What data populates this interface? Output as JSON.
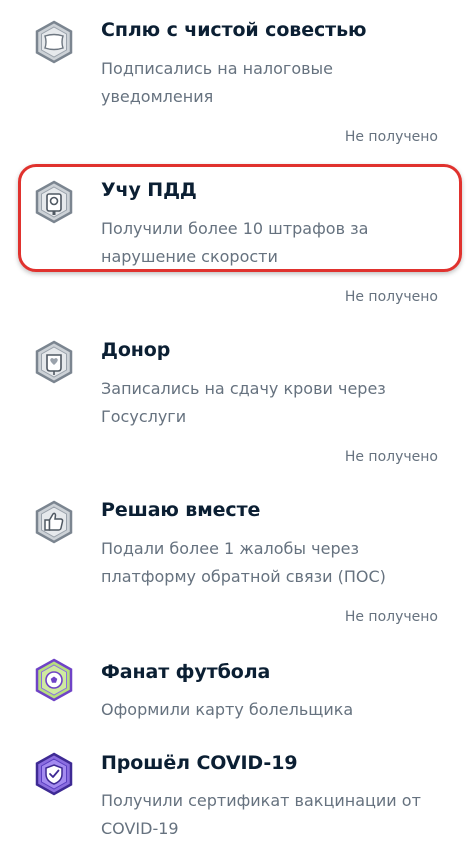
{
  "achievements": [
    {
      "title": "Сплю с чистой совестью",
      "description": "Подписались на налоговые уведомления",
      "status": "Не получено",
      "icon": "pillow-icon",
      "colors": {
        "fill": "#cdd2d7",
        "stroke": "#7b8590"
      }
    },
    {
      "title": "Учу ПДД",
      "description": "Получили более 10 штрафов за нарушение скорости",
      "status": "Не получено",
      "icon": "speed-camera-icon",
      "colors": {
        "fill": "#cdd2d7",
        "stroke": "#7b8590"
      },
      "highlighted": true,
      "highlight_color": "#e0322e"
    },
    {
      "title": "Донор",
      "description": "Записались на сдачу крови через Госуслуги",
      "status": "Не получено",
      "icon": "blood-bag-icon",
      "colors": {
        "fill": "#cdd2d7",
        "stroke": "#7b8590"
      }
    },
    {
      "title": "Решаю вместе",
      "description": "Подали более 1 жалобы через платформу обратной связи (ПОС)",
      "status": "Не получено",
      "icon": "thumbs-up-icon",
      "colors": {
        "fill": "#cdd2d7",
        "stroke": "#7b8590"
      }
    },
    {
      "title": "Фанат футбола",
      "description": "Оформили карту болельщика",
      "status": "",
      "icon": "football-icon",
      "colors": {
        "fill": "#b7df7e",
        "stroke": "#6f43c6"
      }
    },
    {
      "title": "Прошёл COVID-19",
      "description": "Получили сертификат вакцинации от COVID-19",
      "status": "",
      "icon": "covid-shield-icon",
      "colors": {
        "fill": "#8b6ee0",
        "stroke": "#3e2a94"
      }
    }
  ]
}
